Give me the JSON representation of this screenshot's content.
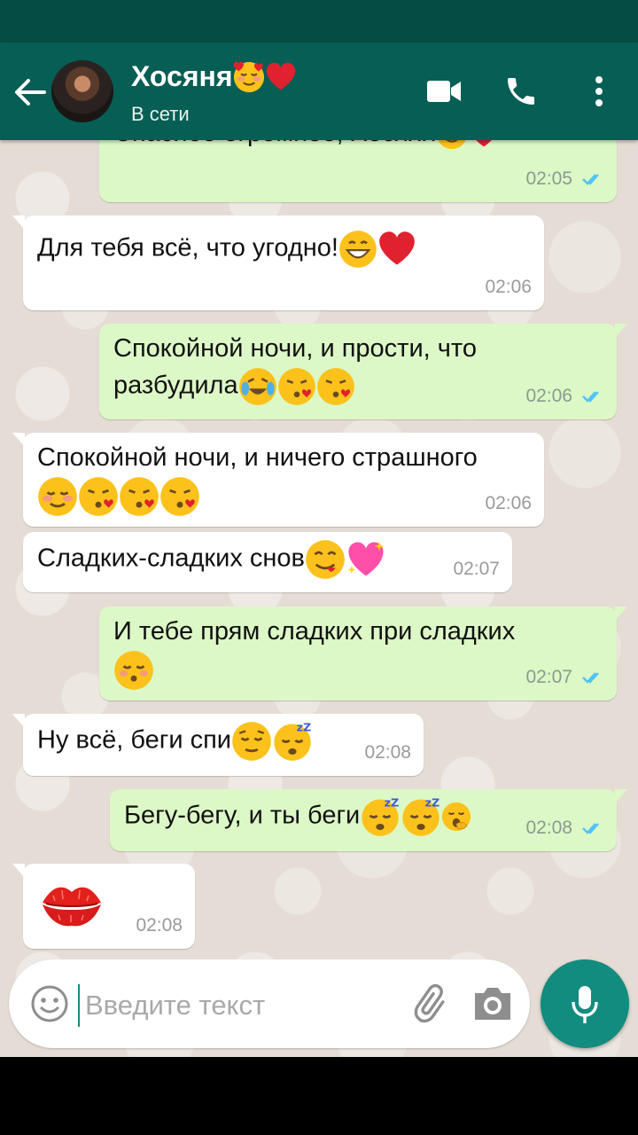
{
  "header": {
    "contact_name": "Хосяня",
    "status": "В сети"
  },
  "messages": [
    {
      "dir": "out",
      "text": "Спасибо огромное, Хосяяя",
      "time": "02:05"
    },
    {
      "dir": "in",
      "text": "Для тебя всё, что угодно!",
      "time": "02:06"
    },
    {
      "dir": "out",
      "text_line1": "Спокойной ночи, и прости, что",
      "text_line2": "разбудила",
      "time": "02:06"
    },
    {
      "dir": "in",
      "text": "Спокойной ночи, и ничего страшного",
      "time": "02:06"
    },
    {
      "dir": "in",
      "text": "Сладких-сладких снов",
      "time": "02:07"
    },
    {
      "dir": "out",
      "text": "И тебе прям сладких при сладких",
      "time": "02:07"
    },
    {
      "dir": "in",
      "text": "Ну всё, беги спи",
      "time": "02:08"
    },
    {
      "dir": "out",
      "text": "Бегу-бегу, и ты беги",
      "time": "02:08"
    },
    {
      "dir": "in",
      "text": "",
      "time": "02:08"
    }
  ],
  "composer": {
    "placeholder": "Введите текст"
  },
  "colors": {
    "header": "#075e54",
    "status_bar": "#054d44",
    "outgoing_bubble": "#dcf8c6",
    "incoming_bubble": "#ffffff",
    "read_ticks": "#4fc3f7",
    "accent": "#128c7e"
  },
  "icons": [
    "back-arrow-icon",
    "video-call-icon",
    "phone-icon",
    "more-vert-icon",
    "emoji-icon",
    "attach-icon",
    "camera-icon",
    "mic-icon",
    "read-ticks-icon",
    "kiss-lips-icon"
  ]
}
